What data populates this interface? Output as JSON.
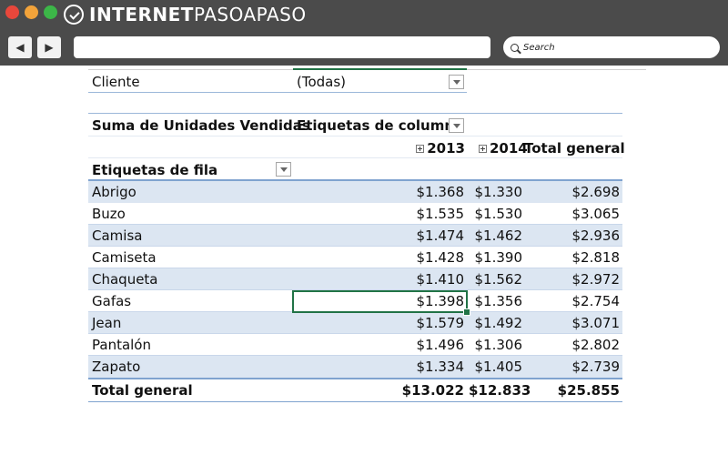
{
  "browser": {
    "brand": "INTERNETPASOAPASO",
    "brand_part1": "INTERNET",
    "brand_part2": "PASOAPASO",
    "search_placeholder": "Search",
    "back_icon": "◀",
    "forward_icon": "▶"
  },
  "pivot": {
    "filter_label": "Cliente",
    "filter_value": "(Todas)",
    "values_label": "Suma de Unidades Vendidas",
    "column_labels": "Etiquetas de columna",
    "row_labels": "Etiquetas de fila",
    "year1": "2013",
    "year2": "2014",
    "grand_total_header": "Total general",
    "rows": [
      {
        "label": "Abrigo",
        "y2013": "$1.368",
        "y2014": "$1.330",
        "total": "$2.698"
      },
      {
        "label": "Buzo",
        "y2013": "$1.535",
        "y2014": "$1.530",
        "total": "$3.065"
      },
      {
        "label": "Camisa",
        "y2013": "$1.474",
        "y2014": "$1.462",
        "total": "$2.936"
      },
      {
        "label": "Camiseta",
        "y2013": "$1.428",
        "y2014": "$1.390",
        "total": "$2.818"
      },
      {
        "label": "Chaqueta",
        "y2013": "$1.410",
        "y2014": "$1.562",
        "total": "$2.972"
      },
      {
        "label": "Gafas",
        "y2013": "$1.398",
        "y2014": "$1.356",
        "total": "$2.754"
      },
      {
        "label": "Jean",
        "y2013": "$1.579",
        "y2014": "$1.492",
        "total": "$3.071"
      },
      {
        "label": "Pantalón",
        "y2013": "$1.496",
        "y2014": "$1.306",
        "total": "$2.802"
      },
      {
        "label": "Zapato",
        "y2013": "$1.334",
        "y2014": "$1.405",
        "total": "$2.739"
      }
    ],
    "grand_total": {
      "label": "Total general",
      "y2013": "$13.022",
      "y2014": "$12.833",
      "total": "$25.855"
    }
  },
  "colors": {
    "band": "#dce6f2",
    "rule": "#9bb7d9",
    "selection": "#217346",
    "chrome": "#4b4b4b"
  }
}
